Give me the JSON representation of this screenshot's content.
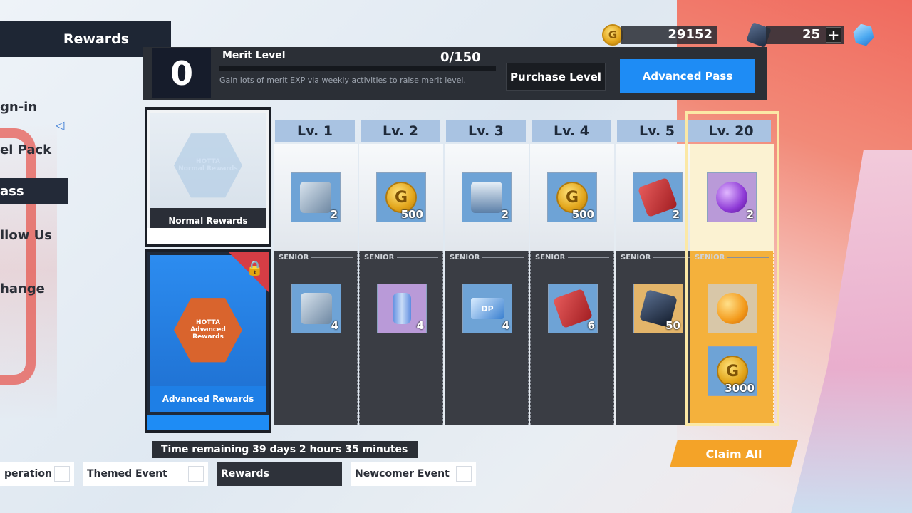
{
  "header": {
    "title": "Rewards"
  },
  "side_menu": [
    {
      "label": "gn-in",
      "active": false
    },
    {
      "label": "el Pack",
      "active": false
    },
    {
      "label": "ass",
      "active": true
    },
    {
      "label": "llow Us",
      "active": false
    },
    {
      "label": "hange",
      "active": false
    }
  ],
  "currency": {
    "gold": "29152",
    "gold_icon_letter": "G",
    "gems": "25",
    "plus": "+"
  },
  "merit": {
    "level": "0",
    "title": "Merit Level",
    "progress": "0/150",
    "progress_fraction": 0,
    "description": "Gain lots of merit EXP via weekly activities to raise merit level.",
    "purchase_label": "Purchase Level",
    "advanced_label": "Advanced Pass"
  },
  "cards": {
    "normal": {
      "caption": "Normal Rewards",
      "emblem_title": "HOTTA",
      "emblem_sub": "Normal Rewards"
    },
    "advanced": {
      "caption": "Advanced Rewards",
      "emblem_title": "HOTTA",
      "emblem_sub": "Advanced Rewards"
    }
  },
  "senior_label": "SENIOR",
  "levels": [
    {
      "label": "Lv. 1",
      "normal": {
        "icon": "chest-icon",
        "count": "2"
      },
      "senior": [
        {
          "icon": "chest-icon",
          "count": "4"
        }
      ]
    },
    {
      "label": "Lv. 2",
      "normal": {
        "icon": "gold-coin-icon",
        "count": "500"
      },
      "senior": [
        {
          "icon": "can-icon",
          "count": "4"
        }
      ]
    },
    {
      "label": "Lv. 3",
      "normal": {
        "icon": "supply-box-icon",
        "count": "2"
      },
      "senior": [
        {
          "icon": "dp-ticket-icon",
          "count": "4"
        }
      ]
    },
    {
      "label": "Lv. 4",
      "normal": {
        "icon": "gold-coin-icon",
        "count": "500"
      },
      "senior": [
        {
          "icon": "red-box-icon",
          "count": "6"
        }
      ]
    },
    {
      "label": "Lv. 5",
      "normal": {
        "icon": "red-box-icon",
        "count": "2"
      },
      "senior": [
        {
          "icon": "dark-cube-icon",
          "count": "50"
        }
      ]
    },
    {
      "label": "Lv. 20",
      "normal": {
        "icon": "purple-orb-icon",
        "count": "2"
      },
      "senior": [
        {
          "icon": "orange-orb-icon",
          "count": ""
        },
        {
          "icon": "gold-coin-icon",
          "count": "3000"
        }
      ]
    }
  ],
  "time_remaining": "Time remaining 39 days 2 hours 35 minutes",
  "claim_all": "Claim All",
  "tabs": [
    {
      "label": "peration",
      "active": false
    },
    {
      "label": "Themed Event",
      "active": false
    },
    {
      "label": "Rewards",
      "active": true
    },
    {
      "label": "Newcomer Event",
      "active": false
    }
  ],
  "colors": {
    "accent_blue": "#1e8cf5",
    "gold_highlight": "#f4b13c",
    "claim_orange": "#f4a328",
    "dark_panel": "#2b2f36"
  }
}
